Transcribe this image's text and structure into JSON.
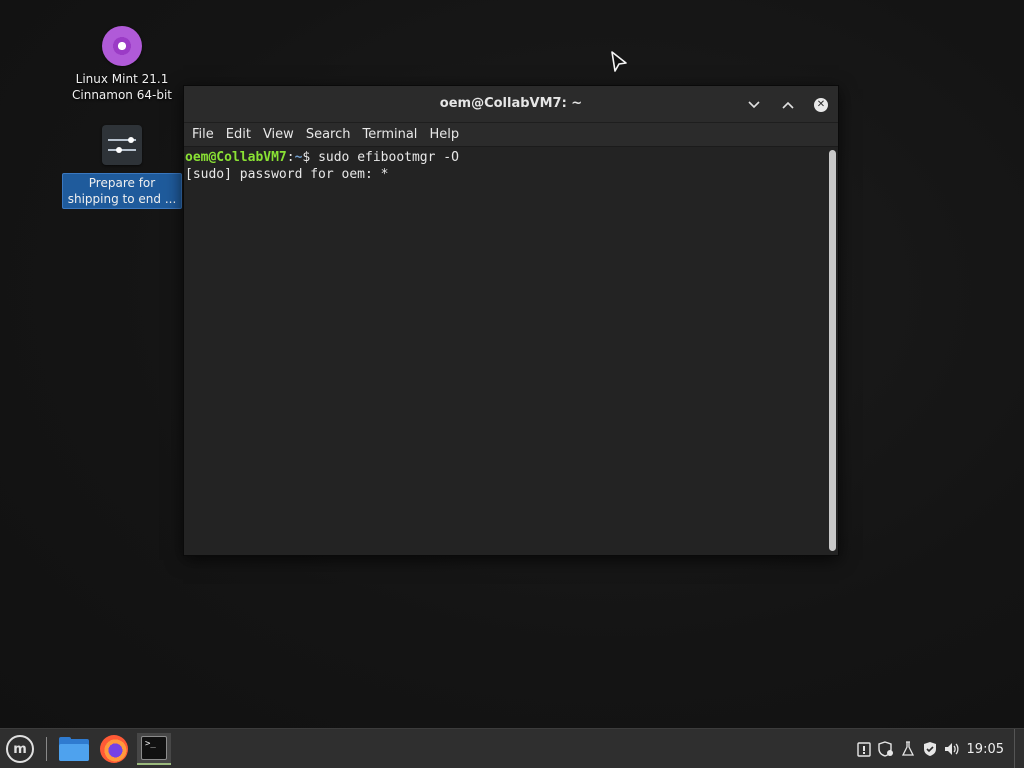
{
  "desktop": {
    "icons": [
      {
        "line1": "Linux Mint 21.1",
        "line2": "Cinnamon 64-bit"
      },
      {
        "line1": "Prepare for",
        "line2": "shipping to end ..."
      }
    ]
  },
  "window": {
    "title": "oem@CollabVM7: ~",
    "controls": {
      "minimize": "⌄",
      "maximize": "⌃",
      "close": "✕"
    },
    "menu": [
      "File",
      "Edit",
      "View",
      "Search",
      "Terminal",
      "Help"
    ],
    "terminal": {
      "prompt_user": "oem@CollabVM7",
      "prompt_sep": ":",
      "prompt_path": "~",
      "prompt_end": "$ ",
      "command": "sudo efibootmgr -O",
      "line2": "[sudo] password for oem: *"
    }
  },
  "taskbar": {
    "menu_logo": "m",
    "terminal_icon_text": ">_",
    "tray": {
      "icons": [
        "update-manager-icon",
        "shield-network-icon",
        "flask-icon",
        "shield-icon",
        "volume-icon"
      ],
      "clock": "19:05"
    }
  },
  "colors": {
    "prompt_user": "#8ae234",
    "prompt_path": "#729fcf",
    "selection": "#1f5b9c",
    "active_indicator": "#9ab87c"
  }
}
